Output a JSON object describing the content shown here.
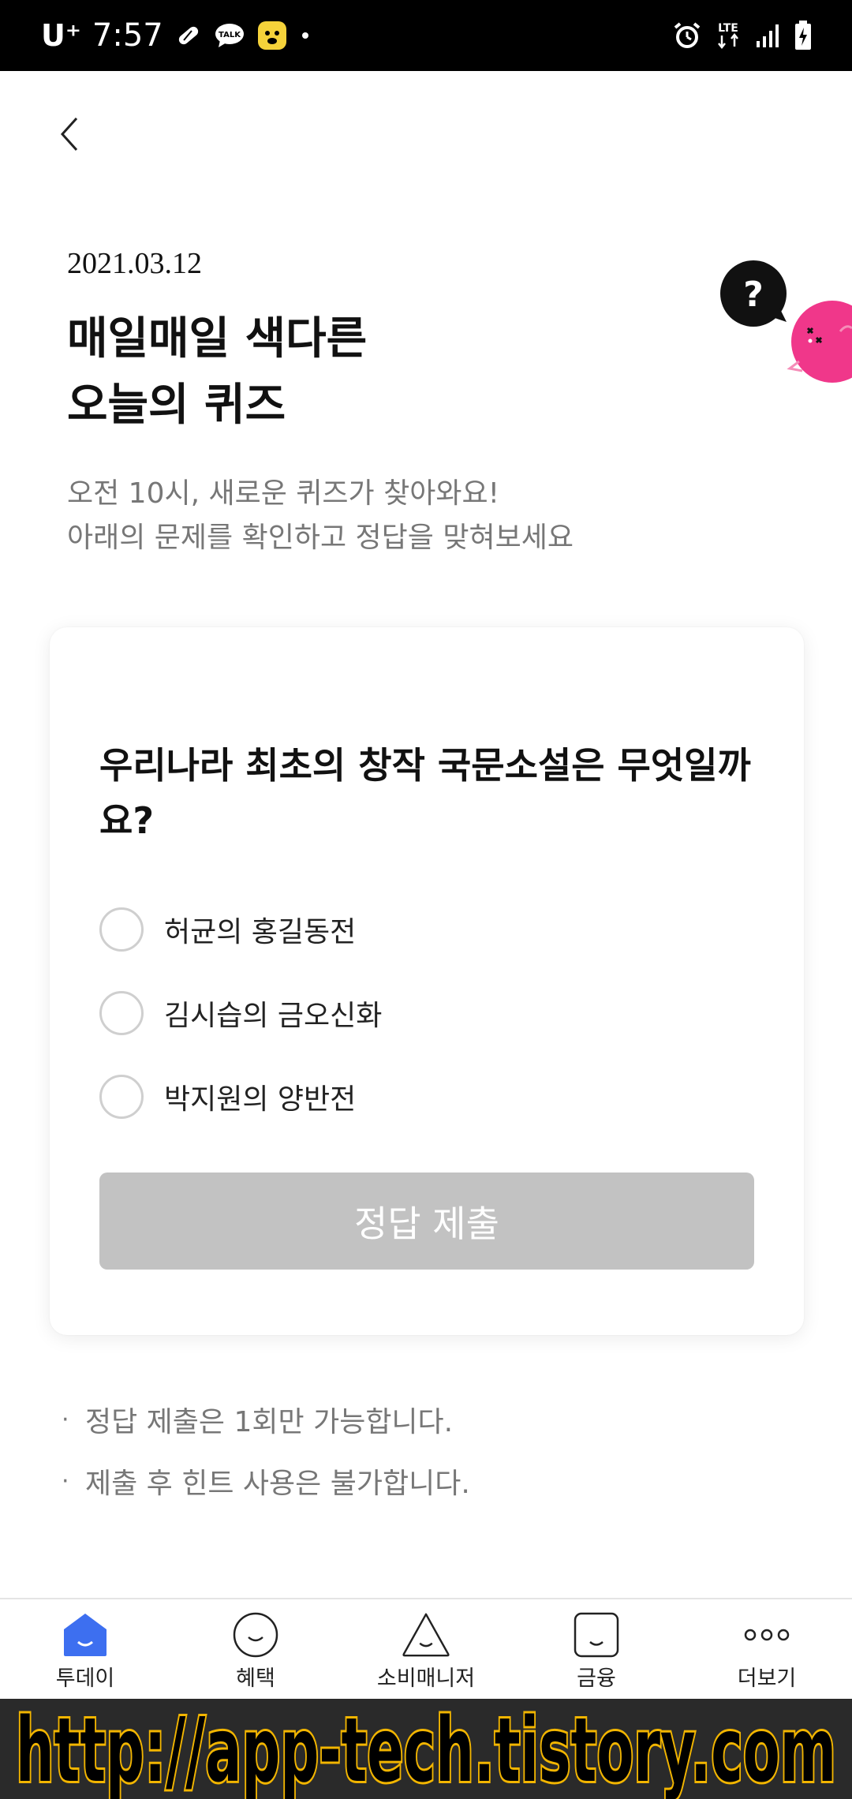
{
  "status_bar": {
    "carrier": "U⁺",
    "time": "7:57",
    "talk_badge": "TALK",
    "network": "LTE"
  },
  "header": {
    "date": "2021.03.12",
    "title_lines": [
      "매일매일 색다른",
      "오늘의 퀴즈"
    ],
    "subtitle_lines": [
      "오전 10시, 새로운 퀴즈가 찾아와요!",
      "아래의 문제를 확인하고 정답을 맞혀보세요"
    ],
    "mascot_bubble": "?"
  },
  "quiz": {
    "question": "우리나라 최초의 창작 국문소설은 무엇일까요?",
    "options": [
      "허균의 홍길동전",
      "김시습의 금오신화",
      "박지원의 양반전"
    ],
    "submit_label": "정답 제출"
  },
  "notes": [
    "정답 제출은 1회만 가능합니다.",
    "제출 후 힌트 사용은 불가합니다."
  ],
  "bottom_nav": {
    "items": [
      {
        "label": "투데이",
        "icon": "home-icon",
        "active": true
      },
      {
        "label": "혜택",
        "icon": "smile-circle-icon",
        "active": false
      },
      {
        "label": "소비매니저",
        "icon": "triangle-face-icon",
        "active": false
      },
      {
        "label": "금융",
        "icon": "square-face-icon",
        "active": false
      },
      {
        "label": "더보기",
        "icon": "more-dots-icon",
        "active": false
      }
    ]
  },
  "watermark": "http://app-tech.tistory.com",
  "colors": {
    "accent": "#3D6FF0",
    "mascot": "#F0378A",
    "button_disabled": "#C2C2C2",
    "watermark_text": "#F2B500"
  }
}
